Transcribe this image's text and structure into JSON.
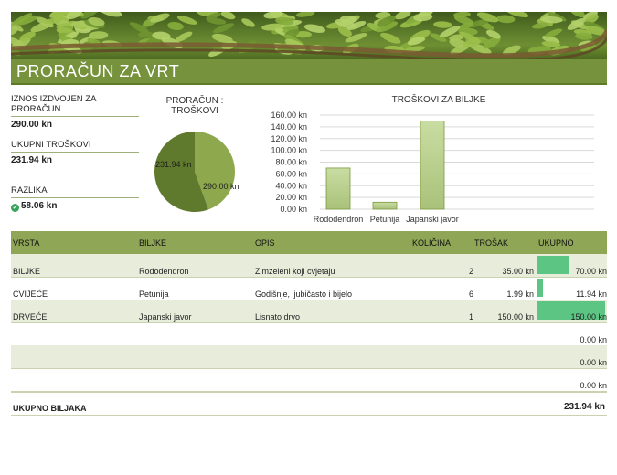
{
  "page_title": "PRORAČUN ZA VRT",
  "summary": {
    "budget_label": "IZNOS IZDVOJEN ZA PRORAČUN",
    "budget_value": "290.00 kn",
    "total_label": "UKUPNI TROŠKOVI",
    "total_value": "231.94 kn",
    "diff_label": "RAZLIKA",
    "diff_value": "58.06 kn",
    "diff_icon": "check-circle-icon",
    "diff_color": "#3aa35a"
  },
  "pie_title_line1": "PRORAČUN :",
  "pie_title_line2": "TROŠKOVI",
  "bar_title": "TROŠKOVI ZA BILJKE",
  "chart_data": [
    {
      "type": "pie",
      "title": "PRORAČUN : TROŠKOVI",
      "slices": [
        {
          "label": "231.94 kn",
          "value": 231.94,
          "color": "#8ea84d"
        },
        {
          "label": "290.00 kn",
          "value": 290.0,
          "color": "#5f7a2c"
        }
      ]
    },
    {
      "type": "bar",
      "title": "TROŠKOVI ZA BILJKE",
      "categories": [
        "Rododendron",
        "Petunija",
        "Japanski javor"
      ],
      "values": [
        70.0,
        11.94,
        150.0
      ],
      "ylim": [
        0,
        160
      ],
      "yticks": [
        "0.00 kn",
        "20.00 kn",
        "40.00 kn",
        "60.00 kn",
        "80.00 kn",
        "100.00 kn",
        "120.00 kn",
        "140.00 kn",
        "160.00 kn"
      ],
      "grid": true,
      "bar_color": "#a9c27a"
    }
  ],
  "table": {
    "headers": {
      "vrsta": "VRSTA",
      "biljke": "BILJKE",
      "opis": "OPIS",
      "kolicina": "KOLIČINA",
      "trosak": "TROŠAK",
      "ukupno": "UKUPNO"
    },
    "rows": [
      {
        "vrsta": "BILJKE",
        "biljke": "Rododendron",
        "opis": "Zimzeleni koji cvjetaju",
        "kolicina": "2",
        "trosak": "35.00 kn",
        "ukupno": "70.00 kn",
        "ukupno_value": 70.0
      },
      {
        "vrsta": "CVIJEĆE",
        "biljke": "Petunija",
        "opis": "Godišnje, ljubičasto i bijelo",
        "kolicina": "6",
        "trosak": "1.99 kn",
        "ukupno": "11.94 kn",
        "ukupno_value": 11.94
      },
      {
        "vrsta": "DRVEĆE",
        "biljke": "Japanski javor",
        "opis": "Lisnato drvo",
        "kolicina": "1",
        "trosak": "150.00 kn",
        "ukupno": "150.00 kn",
        "ukupno_value": 150.0
      },
      {
        "vrsta": "",
        "biljke": "",
        "opis": "",
        "kolicina": "",
        "trosak": "",
        "ukupno": "0.00 kn",
        "ukupno_value": 0
      },
      {
        "vrsta": "",
        "biljke": "",
        "opis": "",
        "kolicina": "",
        "trosak": "",
        "ukupno": "0.00 kn",
        "ukupno_value": 0
      },
      {
        "vrsta": "",
        "biljke": "",
        "opis": "",
        "kolicina": "",
        "trosak": "",
        "ukupno": "0.00 kn",
        "ukupno_value": 0
      }
    ],
    "total_label": "UKUPNO BILJAKA",
    "total_value": "231.94 kn",
    "databar_color": "#5cc584",
    "databar_max": 150.0
  }
}
